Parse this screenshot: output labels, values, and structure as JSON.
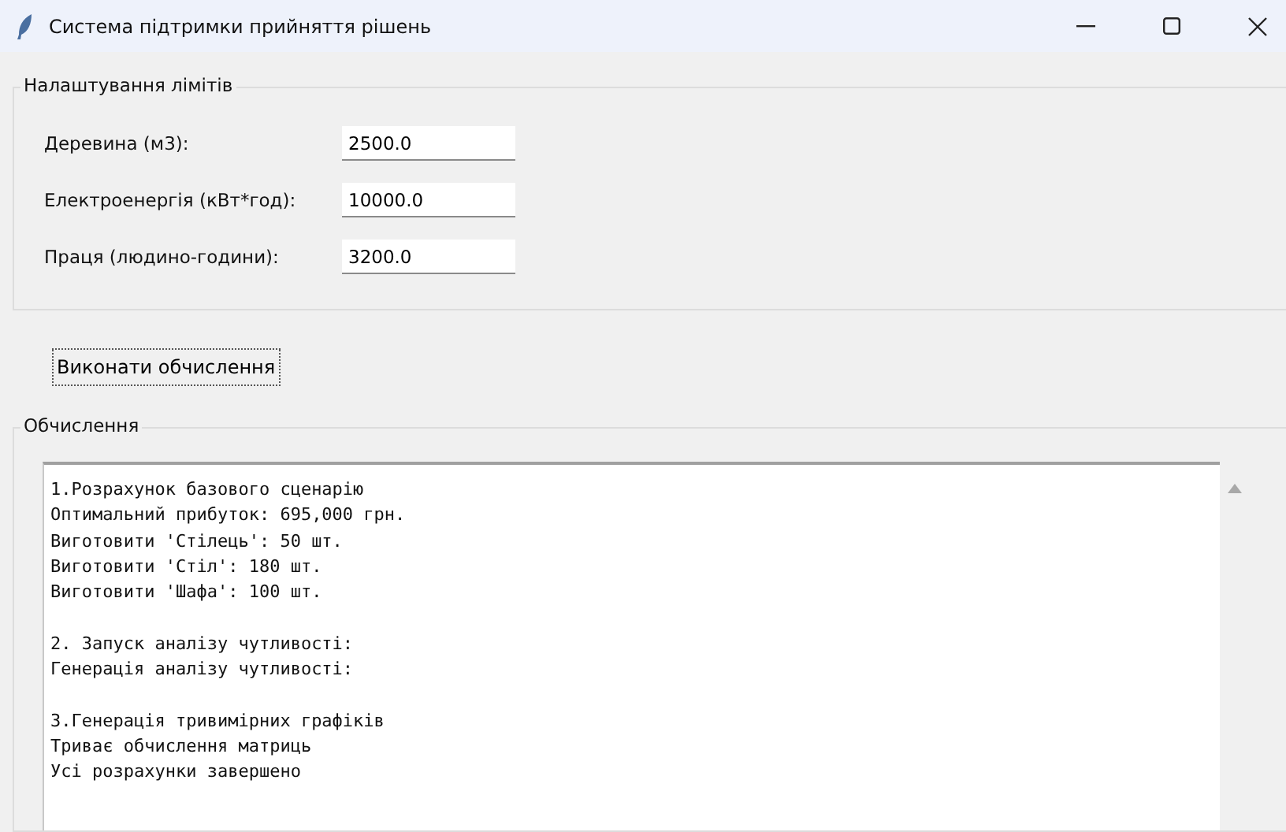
{
  "window": {
    "title": "Система підтримки прийняття рішень"
  },
  "limits": {
    "title": "Налаштування лімітів",
    "fields": [
      {
        "label": "Деревина (м3):",
        "value": "2500.0"
      },
      {
        "label": "Електроенергія (кВт*год):",
        "value": "10000.0"
      },
      {
        "label": "Праця (людино-години):",
        "value": "3200.0"
      }
    ]
  },
  "run_button": "Виконати обчислення",
  "output": {
    "title": "Обчислення",
    "blocks": [
      [
        "1.Розрахунок базового сценарію",
        "Оптимальний прибуток: 695,000 грн.",
        "Виготовити 'Стілець': 50 шт.",
        "Виготовити 'Стіл': 180 шт.",
        "Виготовити 'Шафа': 100 шт."
      ],
      [
        "2. Запуск аналізу чутливості:",
        "Генерація аналізу чутливості:"
      ],
      [
        "3.Генерація тривимірних графіків",
        "Триває обчислення матриць",
        "Усі розрахунки завершено"
      ]
    ]
  }
}
